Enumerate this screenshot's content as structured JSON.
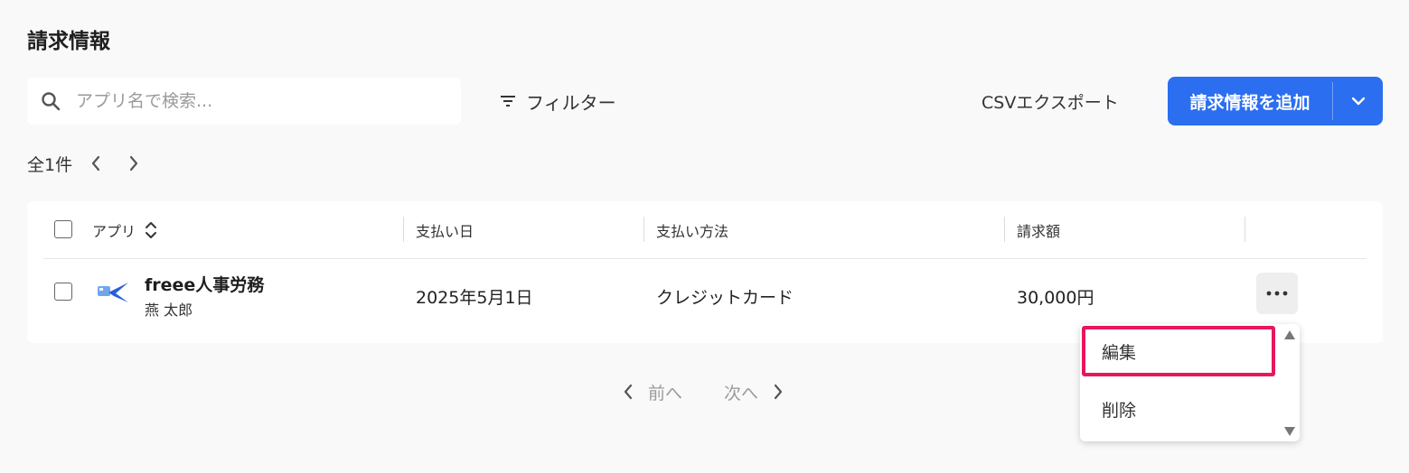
{
  "page": {
    "title": "請求情報"
  },
  "search": {
    "placeholder": "アプリ名で検索...",
    "value": "",
    "icon": "search-icon"
  },
  "toolbar": {
    "filter_label": "フィルター",
    "csv_label": "CSVエクスポート",
    "add_label": "請求情報を追加",
    "accent": "#2b6ef0"
  },
  "count": {
    "label": "全1件"
  },
  "table": {
    "headers": {
      "app": "アプリ",
      "pay_date": "支払い日",
      "pay_method": "支払い方法",
      "amount": "請求額"
    },
    "rows": [
      {
        "app_name": "freee人事労務",
        "user": "燕 太郎",
        "pay_date": "2025年5月1日",
        "pay_method": "クレジットカード",
        "amount": "30,000円"
      }
    ]
  },
  "pager": {
    "prev_label": "前へ",
    "next_label": "次へ"
  },
  "menu": {
    "items": [
      {
        "label": "編集"
      },
      {
        "label": "削除"
      }
    ],
    "highlight_color": "#e8175d"
  }
}
